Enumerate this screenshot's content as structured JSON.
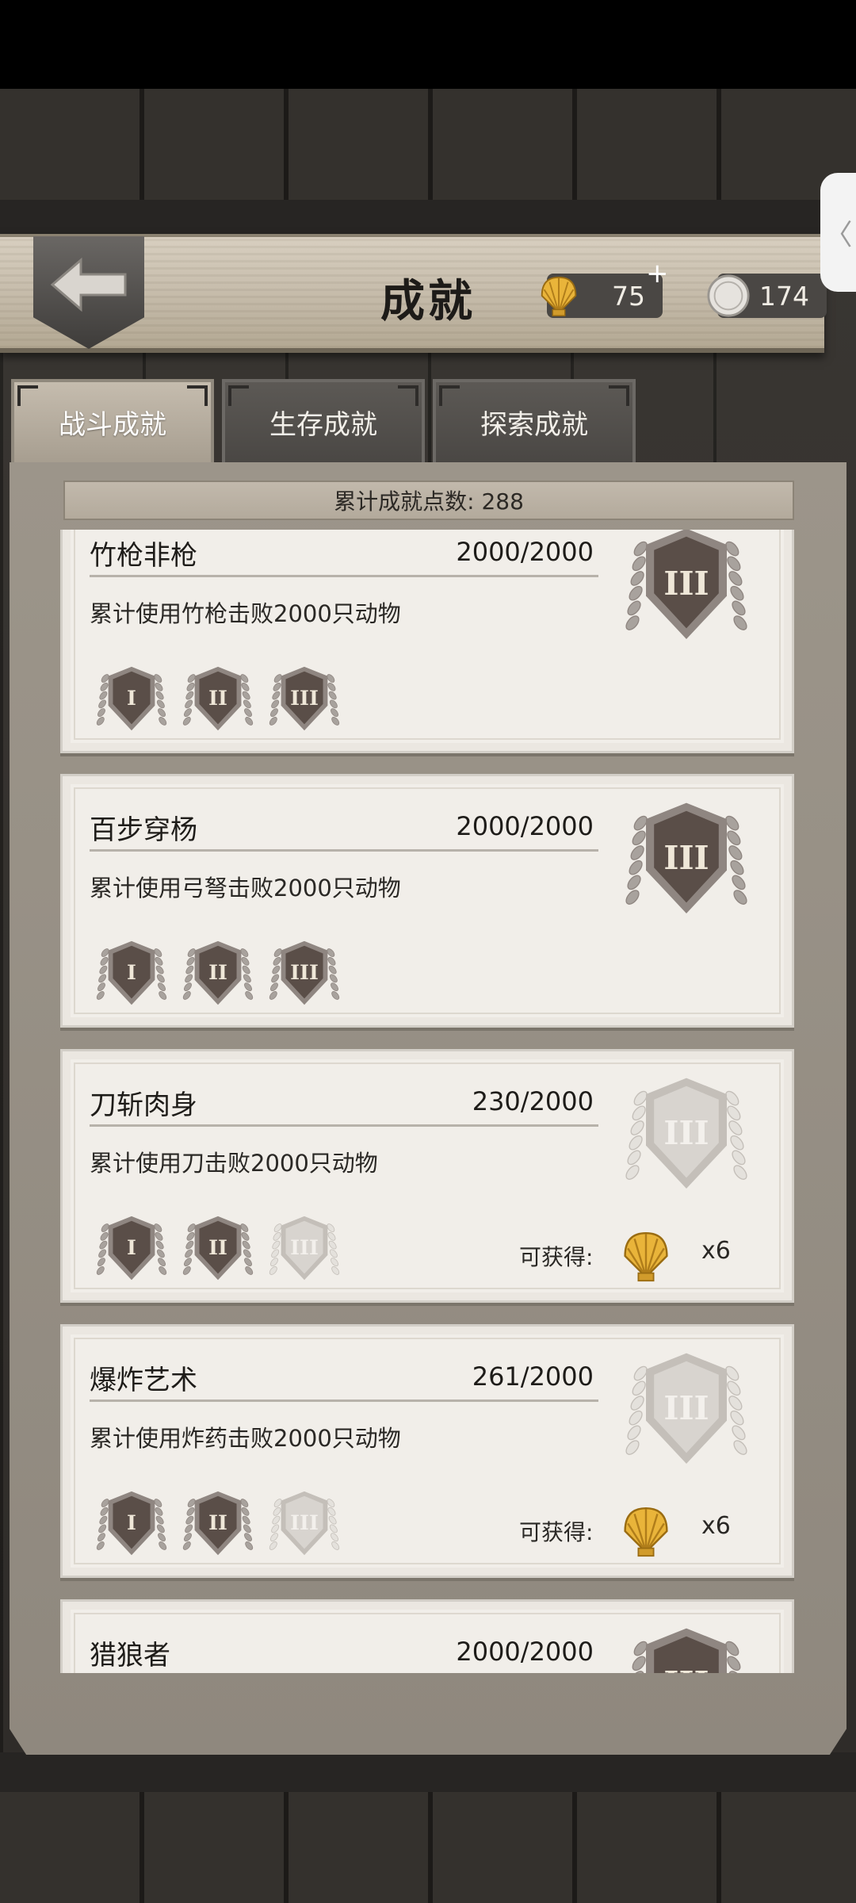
{
  "header": {
    "title": "成就",
    "shells": "75",
    "shells_plus": "+",
    "coins": "174"
  },
  "tabs": [
    {
      "label": "战斗成就",
      "active": true
    },
    {
      "label": "生存成就",
      "active": false
    },
    {
      "label": "探索成就",
      "active": false
    }
  ],
  "summary": {
    "text": "累计成就点数: 288"
  },
  "achievements": [
    {
      "name": "竹枪非枪",
      "progress": "2000/2000",
      "desc": "累计使用竹枪击败2000只动物",
      "tiers_done": 3,
      "completed": true
    },
    {
      "name": "百步穿杨",
      "progress": "2000/2000",
      "desc": "累计使用弓弩击败2000只动物",
      "tiers_done": 3,
      "completed": true
    },
    {
      "name": "刀斩肉身",
      "progress": "230/2000",
      "desc": "累计使用刀击败2000只动物",
      "tiers_done": 2,
      "completed": false,
      "reward_label": "可获得:",
      "reward_count": "x6"
    },
    {
      "name": "爆炸艺术",
      "progress": "261/2000",
      "desc": "累计使用炸药击败2000只动物",
      "tiers_done": 2,
      "completed": false,
      "reward_label": "可获得:",
      "reward_count": "x6"
    },
    {
      "name": "猎狼者",
      "progress": "2000/2000",
      "desc": "",
      "tiers_done": 3,
      "completed": true
    }
  ],
  "tier_numerals": [
    "I",
    "II",
    "III"
  ],
  "colors": {
    "medal_dark": "#5a4e48",
    "medal_silver": "#c9c3bc",
    "medal_faded": "#d8d4cf",
    "shell_gold": "#e9b43a"
  }
}
